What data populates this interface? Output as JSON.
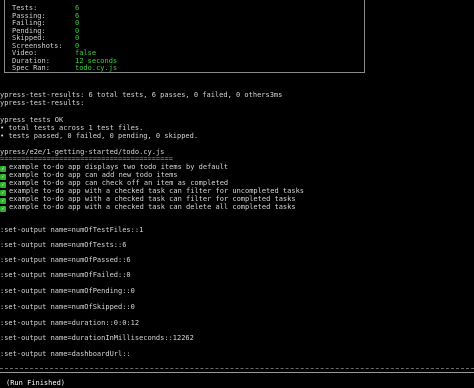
{
  "summary": {
    "rows": [
      {
        "key": "Tests:",
        "value": "6"
      },
      {
        "key": "Passing:",
        "value": "6"
      },
      {
        "key": "Failing:",
        "value": "0"
      },
      {
        "key": "Pending:",
        "value": "0"
      },
      {
        "key": "Skipped:",
        "value": "0"
      },
      {
        "key": "Screenshots:",
        "value": "0"
      },
      {
        "key": "Video:",
        "value": "false"
      },
      {
        "key": "Duration:",
        "value": "12 seconds"
      },
      {
        "key": "Spec Ran:",
        "value": "todo.cy.js"
      }
    ]
  },
  "results": {
    "line1": "ypress-test-results: 6 total tests, 6 passes, 0 failed, 0 others3ms",
    "line2": "ypress-test-results:",
    "ok_title": "ypress tests OK",
    "ok_line1": "• total tests across 1 test files.",
    "ok_line2": "• tests passed, 0 failed, 0 pending, 0 skipped."
  },
  "spec": {
    "path": "ypress/e2e/1-getting-started/todo.cy.js",
    "underline": "=========================================",
    "tests": [
      "example to-do app displays two todo items by default",
      "example to-do app can add new todo items",
      "example to-do app can check off an item as completed",
      "example to-do app with a checked task can filter for uncompleted tasks",
      "example to-do app with a checked task can filter for completed tasks",
      "example to-do app with a checked task can delete all completed tasks"
    ]
  },
  "outputs": [
    ":set-output name=numOfTestFiles::1",
    ":set-output name=numOfTests::6",
    ":set-output name=numOfPassed::6",
    ":set-output name=numOfFailed::0",
    ":set-output name=numOfPending::0",
    ":set-output name=numOfSkipped::0",
    ":set-output name=duration::0:0:12",
    ":set-output name=durationInMilliseconds::12262",
    ":set-output name=dashboardUrl::"
  ],
  "footer": {
    "run_finished": "(Run Finished)"
  },
  "colors": {
    "background": "#000000",
    "text": "#d6d6d6",
    "value_green": "#35d435",
    "check_green": "#2fb12f"
  }
}
